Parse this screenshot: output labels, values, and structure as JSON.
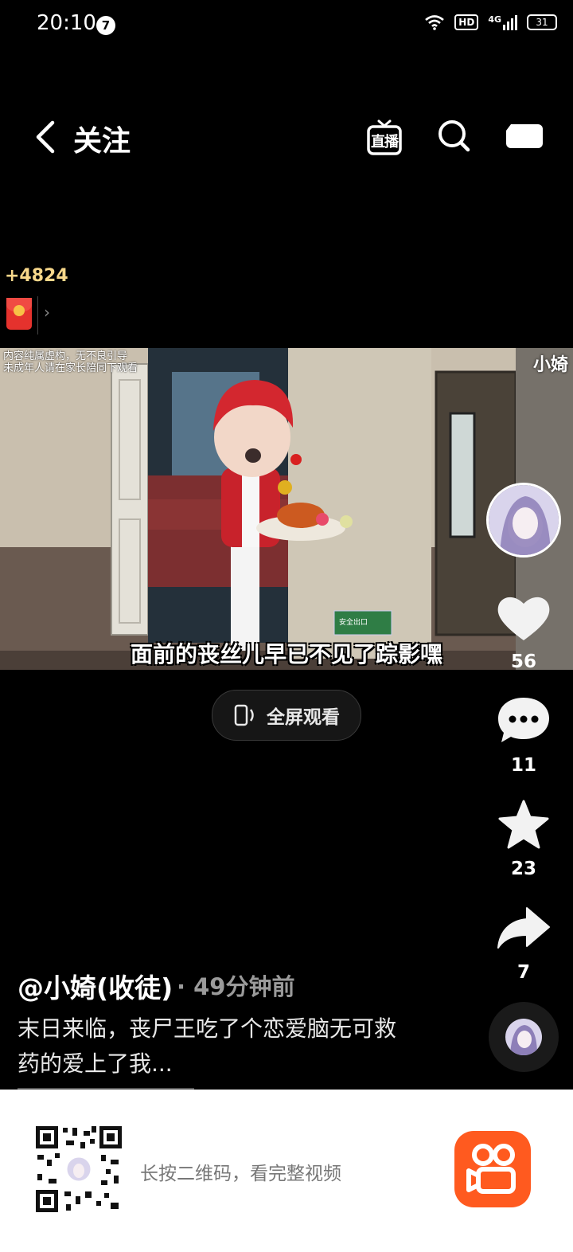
{
  "status_bar": {
    "time": "20:10",
    "notification_count": "7",
    "hd": "HD",
    "network": "4G",
    "battery": "31"
  },
  "nav": {
    "back_icon": "chevron-left-icon",
    "title": "关注",
    "live_label": "直播",
    "search_icon": "search-icon",
    "camera_icon": "camera-icon"
  },
  "reward": {
    "points": "+4824",
    "icon": "red-packet-icon",
    "arrow": "›"
  },
  "video": {
    "warning_line1": "内容纯属虚构，无不良引导",
    "warning_line2": "未成年人请在家长陪同下观看",
    "watermark": "小婍",
    "subtitle": "面前的丧丝儿早已不见了踪影嘿",
    "exit_sign": "安全出口"
  },
  "fullscreen": {
    "label": "全屏观看",
    "icon": "phone-rotate-icon"
  },
  "rail": {
    "like_count": "56",
    "comment_count": "11",
    "favorite_count": "23",
    "share_count": "7"
  },
  "meta": {
    "author": "@小婍(收徒)",
    "time_ago": "· 49分钟前",
    "description": "末日来临，丧尸王吃了个恋爱脑无可救药的爱上了我..."
  },
  "footer": {
    "qr_text": "长按二维码，看完整视频",
    "qr_icon": "qr-code-icon",
    "app_logo": "kuaishou-logo"
  },
  "colors": {
    "accent_reward": "#f7d78a",
    "app_brand": "#ff5a1f",
    "red_packet": "#e5322d"
  }
}
